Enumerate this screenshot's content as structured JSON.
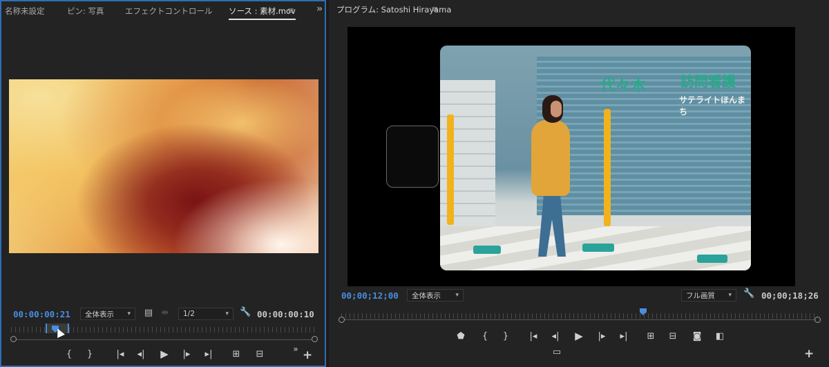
{
  "source_panel": {
    "tabs": [
      "名称未設定",
      "ピン: 写真",
      "エフェクトコントロール",
      "ソース : 素材.mov"
    ],
    "menu_icon": "hamburger-icon",
    "expand_icon": "double-chevron-right-icon",
    "timecode_in": "00:00:00:21",
    "zoom_select": "全体表示",
    "resolution_select": "1/2",
    "duration": "00:00:00:10"
  },
  "program_panel": {
    "title": "プログラム: Satoshi Hirayama",
    "menu_icon": "hamburger-icon",
    "timecode_current": "00;00;12;00",
    "zoom_select": "全体表示",
    "quality_select": "フル画質",
    "duration": "00;00;18;26",
    "signage": {
      "sign1": "代々木",
      "sign2": "訪問看護",
      "sign3": "サテライトほんまち"
    }
  },
  "colors": {
    "accent": "#4a8ee0",
    "panel_border_active": "#2d6fb4",
    "panel_bg": "#232323"
  }
}
